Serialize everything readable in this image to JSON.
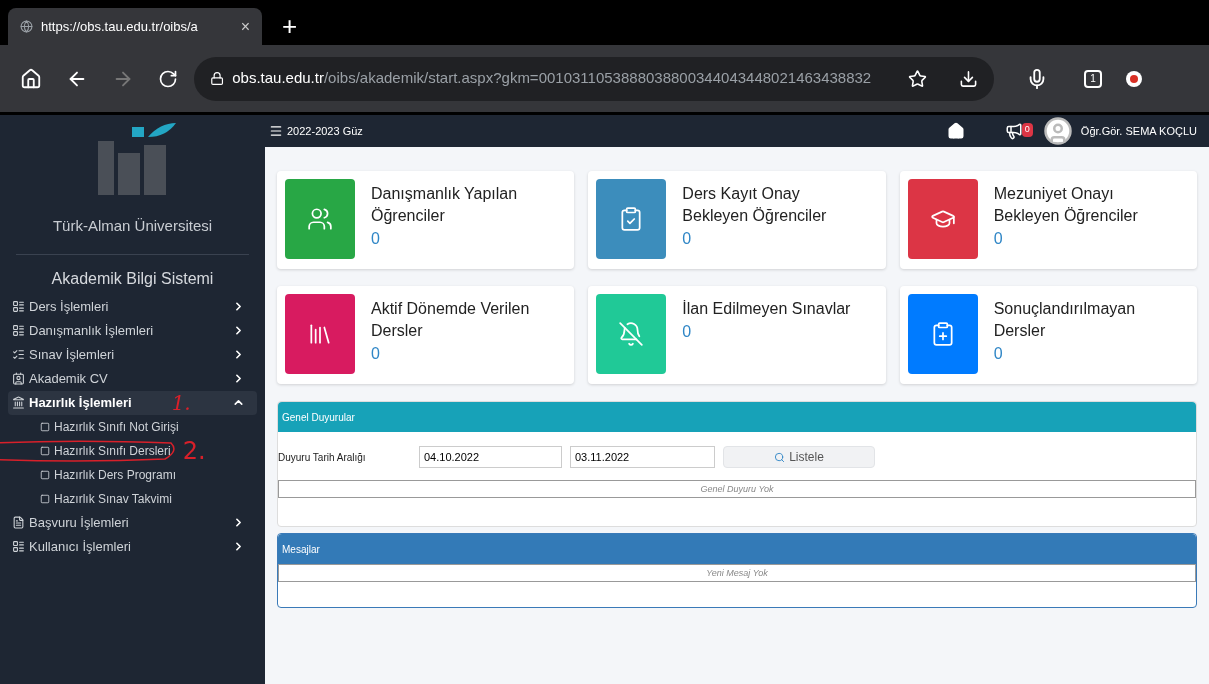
{
  "browser": {
    "tab_title": "https://obs.tau.edu.tr/oibs/a",
    "tab_close": "×",
    "new_tab": "+",
    "url_host": "obs.tau.edu.tr",
    "url_path": "/oibs/akademik/start.aspx?gkm=0010311053888038800344043448021463438832",
    "tab_count": "1"
  },
  "sidebar": {
    "university": "Türk-Alman Üniversitesi",
    "system": "Akademik Bilgi Sistemi",
    "items": [
      {
        "label": "Ders İşlemleri",
        "expanded": false
      },
      {
        "label": "Danışmanlık İşlemleri",
        "expanded": false
      },
      {
        "label": "Sınav İşlemleri",
        "expanded": false
      },
      {
        "label": "Akademik CV",
        "expanded": false
      },
      {
        "label": "Hazırlık İşlemleri",
        "expanded": true,
        "annotation": "1.",
        "children": [
          {
            "label": "Hazırlık Sınıfı Not Girişi"
          },
          {
            "label": "Hazırlık Sınıfı Dersleri",
            "annotation": "2."
          },
          {
            "label": "Hazırlık Ders Programı"
          },
          {
            "label": "Hazırlık Sınav Takvimi"
          }
        ]
      },
      {
        "label": "Başvuru İşlemleri",
        "expanded": false
      },
      {
        "label": "Kullanıcı İşlemleri",
        "expanded": false
      }
    ]
  },
  "header": {
    "term": "2022-2023 Güz",
    "notification_count": "0",
    "user": "Öğr.Gör. SEMA KOÇLU"
  },
  "cards": [
    {
      "title": "Danışmanlık Yapılan Öğrenciler",
      "count": "0",
      "color": "#28a745"
    },
    {
      "title": "Ders Kayıt Onay Bekleyen Öğrenciler",
      "count": "0",
      "color": "#3c8dbc"
    },
    {
      "title": "Mezuniyet Onayı Bekleyen Öğrenciler",
      "count": "0",
      "color": "#dc3545"
    },
    {
      "title": "Aktif Dönemde Verilen Dersler",
      "count": "0",
      "color": "#d81b60"
    },
    {
      "title": "İlan Edilmeyen Sınavlar",
      "count": "0",
      "color": "#20c997"
    },
    {
      "title": "Sonuçlandırılmayan Dersler",
      "count": "0",
      "color": "#007bff"
    }
  ],
  "announcements": {
    "title": "Genel Duyurular",
    "date_label": "Duyuru Tarih Aralığı",
    "date_from": "04.10.2022",
    "date_to": "03.11.2022",
    "button": "Listele",
    "empty": "Genel Duyuru Yok"
  },
  "messages": {
    "title": "Mesajlar",
    "empty": "Yeni Mesaj Yok"
  }
}
